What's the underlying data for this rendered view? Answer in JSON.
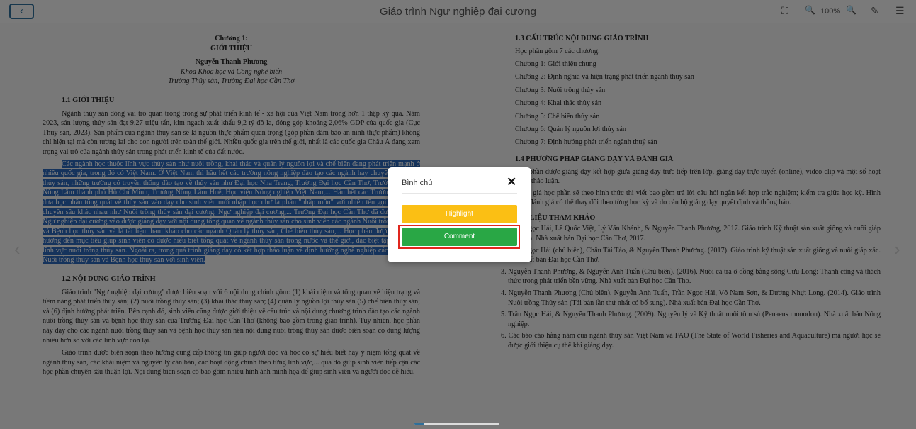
{
  "header": {
    "back_icon": "‹",
    "title": "Giáo trình Ngư nghiệp đại cương",
    "zoom": "100%",
    "fullscreen_icon": "⛶",
    "zoom_out_icon": "🔍",
    "zoom_in_icon": "🔍",
    "pen_icon": "✎",
    "menu_icon": "☰"
  },
  "left_page": {
    "chapter": "Chương 1:",
    "chapter_title": "GIỚI THIỆU",
    "author": "Nguyễn Thanh Phương",
    "affiliation1": "Khoa Khoa học và Công nghệ biển",
    "affiliation2": "Trường Thủy sản, Trường Đại học Cần Thơ",
    "s1_heading": "1.1 GIỚI THIỆU",
    "p1": "Ngành thủy sản đóng vai trò quan trọng trong sự phát triển kinh tế - xã hội của Việt Nam trong hơn 1 thập kỷ qua. Năm 2023, sản lượng thủy sản đạt 9,27 triệu tấn, kim ngạch xuất khẩu 9,2 tỷ đô-la, đóng góp khoảng 2,06% GDP của quốc gia (Cục Thủy sản, 2023). Sản phẩm của ngành thủy sản sẽ là nguồn thực phẩm quan trọng (góp phần đảm bảo an ninh thực phẩm) không chỉ hiện tại mà còn tương lai cho con người trên toàn thế giới. Nhiều quốc gia trên thế giới, nhất là các quốc gia Châu Á đang xem trọng vai trò của ngành thủy sản trong phát triển kinh tế của đất nước.",
    "p2": "Các ngành học thuộc lĩnh vực thủy sản như nuôi trồng, khai thác và quản lý nguồn lợi và chế biến đang phát triển mạnh ở nhiều quốc gia, trong đó có Việt Nam. Ở Việt Nam thì hầu hết các trường nông nghiệp đào tạo các ngành hay chuyên ngành về thủy sản, những trường có truyền thống đào tạo về thủy sản như Đại học Nha Trang, Trường Đại học Cần Thơ, Trường Đại học Nông Lâm thành phố Hồ Chí Minh, Trường Nông Lâm Huế, Học viện Nông nghiệp Việt Nam,... Hầu hết các Trường/Viện đều đưa học phần tổng quát về thủy sản vào dạy cho sinh viên mới nhập học như là phần \"nhập môn\" với nhiều tên gọi và mức độ chuyên sâu khác nhau như Nuôi trồng thủy sản đại cương, Ngư nghiệp đại cương,... Trường Đại học Cần Thơ đã đưa học phần Ngư nghiệp đại cương vào được giảng dạy với nội dung tổng quan về ngành thủy sản cho sinh viên các ngành Nuôi trồng thủy sản và Bệnh học thủy sản và là tài liệu tham khảo cho các ngành Quản lý thủy sản, Chế biến thủy sản,... Học phần được giảng dạy hướng đến mục tiêu giúp sinh viên có được hiểu biết tổng quát về ngành thủy sản trong nước và thế giới, đặc biệt tập trung vào lĩnh vực nuôi trồng thủy sản. Ngoài ra, trong quá trình giảng dạy có kết hợp thảo luận về định hướng nghề nghiệp các ngành học Nuôi trồng thủy sản và Bệnh học thủy sản với sinh viên.",
    "s2_heading": "1.2 NỘI DUNG GIÁO TRÌNH",
    "p3": "Giáo trình \"Ngư nghiệp đại cương\" được biên soạn với 6 nội dung chính gồm: (1) khái niệm và tổng quan về hiện trạng và tiềm năng phát triển thủy sản; (2) nuôi trồng thủy sản; (3) khai thác thủy sản; (4) quản lý nguồn lợi thủy sản (5) chế biến thủy sản; và (6) định hướng phát triển. Bên cạnh đó, sinh viên cũng được giới thiệu về cấu trúc và nội dung chương trình đào tạo các ngành nuôi trồng thủy sản và bệnh học thủy sản của Trường Đại học Cần Thơ (không bao gồm trong giáo trình). Tuy nhiên, học phần này dạy cho các ngành nuôi trồng thủy sản và bệnh học thủy sản nên nội dung nuôi trồng thủy sản được biên soạn có dung lượng nhiều hơn so với các lĩnh vực còn lại.",
    "p4": "Giáo trình được biên soạn theo hướng cung cấp thông tin giúp người đọc và học có sự hiểu biết hay ý niệm tổng quát về ngành thủy sản, các khái niệm và nguyên lý căn bản, các hoạt động chính theo từng lĩnh vực,... qua đó giúp sinh viên tiếp cận các học phần chuyên sâu thuận lợi. Nội dung biên soạn có bao gồm nhiều hình ảnh minh họa để giúp sinh viên và người đọc dễ hiểu."
  },
  "right_page": {
    "s3_heading": "1.3 CẤU TRÚC NỘI DUNG GIÁO TRÌNH",
    "intro": "Học phần gồm 7 các chương:",
    "chapters": [
      "Chương 1: Giới thiệu chung",
      "Chương 2: Định nghĩa và hiện trạng phát triển ngành thủy sản",
      "Chương 3: Nuôi trồng thủy sản",
      "Chương 4: Khai thác thủy sản",
      "Chương 5: Chế biến thủy sản",
      "Chương 6: Quản lý nguồn lợi thủy sản",
      "Chương 7: Định hướng phát triển ngành thuỷ sản"
    ],
    "s4_heading": "1.4 PHƯƠNG PHÁP GIẢNG DẠY VÀ ĐÁNH GIÁ",
    "p5": "Học phần được giảng dạy kết hợp giữa giảng dạy trực tiếp trên lớp, giảng dạy trực tuyến (online), video clip và một số hoạt động thảo luận.",
    "p6": "Đánh giá học phần sẽ theo hình thức thi viết bao gồm trả lời câu hỏi ngắn kết hợp trắc nghiệm; kiểm tra giữa học kỳ. Hình thức đánh giá có thể thay đổi theo từng học kỳ và do cán bộ giảng dạy quyết định và thông báo.",
    "s5_heading": "TÀI LIỆU THAM KHẢO",
    "refs": [
      "Trần Ngọc Hải, Lê Quốc Việt, Lý Văn Khánh, & Nguyễn Thanh Phương, 2017. Giáo trình Kỹ thuật sản xuất giống và nuôi giáp xác biển. Nhà xuất bản Đại học Cần Thơ, 2017.",
      "Trần Ngọc Hải (chủ biên), Châu Tài Tảo, & Nguyễn Thanh Phương. (2017). Giáo trình kỹ thuật sản xuất giống và nuôi giáp xác. Nhà xuất bản Đại học Cần Thơ.",
      "Nguyễn Thanh Phương, & Nguyễn Anh Tuấn (Chủ biên). (2016). Nuôi cá tra ở đồng bằng sông Cửu Long: Thành công và thách thức trong phát triển bền vững. Nhà xuất bản Đại học Cần Thơ.",
      "Nguyễn Thanh Phương (Chủ biên), Nguyễn Anh Tuấn, Trần Ngọc Hải, Võ Nam Sơn, & Dương Nhựt Long. (2014). Giáo trình Nuôi trồng Thủy sản (Tái bản lần thứ nhất có bổ sung). Nhà xuất bản Đại học Cần Thơ.",
      "Trần Ngọc Hải, & Nguyễn Thanh Phương. (2009). Nguyên lý và Kỹ thuật nuôi tôm sú (Penaeus monodon). Nhà xuất bản Nông nghiệp.",
      "Các báo cáo hằng năm của ngành thủy sản Việt Nam và FAO (The State of World Fisheries and Aquaculture) mà người học sẽ được giới thiệu cụ thể khi giảng dạy."
    ]
  },
  "modal": {
    "title": "Bình chú",
    "close_icon": "✕",
    "highlight_label": "Highlight",
    "comment_label": "Comment"
  },
  "nav": {
    "prev_icon": "‹",
    "next_icon": "›"
  },
  "progress": {
    "fraction": 0.12
  },
  "colors": {
    "highlight_btn": "#fbbf14",
    "comment_btn": "#29a745",
    "focus_border": "#e0261e",
    "selection": "#2a66b8"
  }
}
